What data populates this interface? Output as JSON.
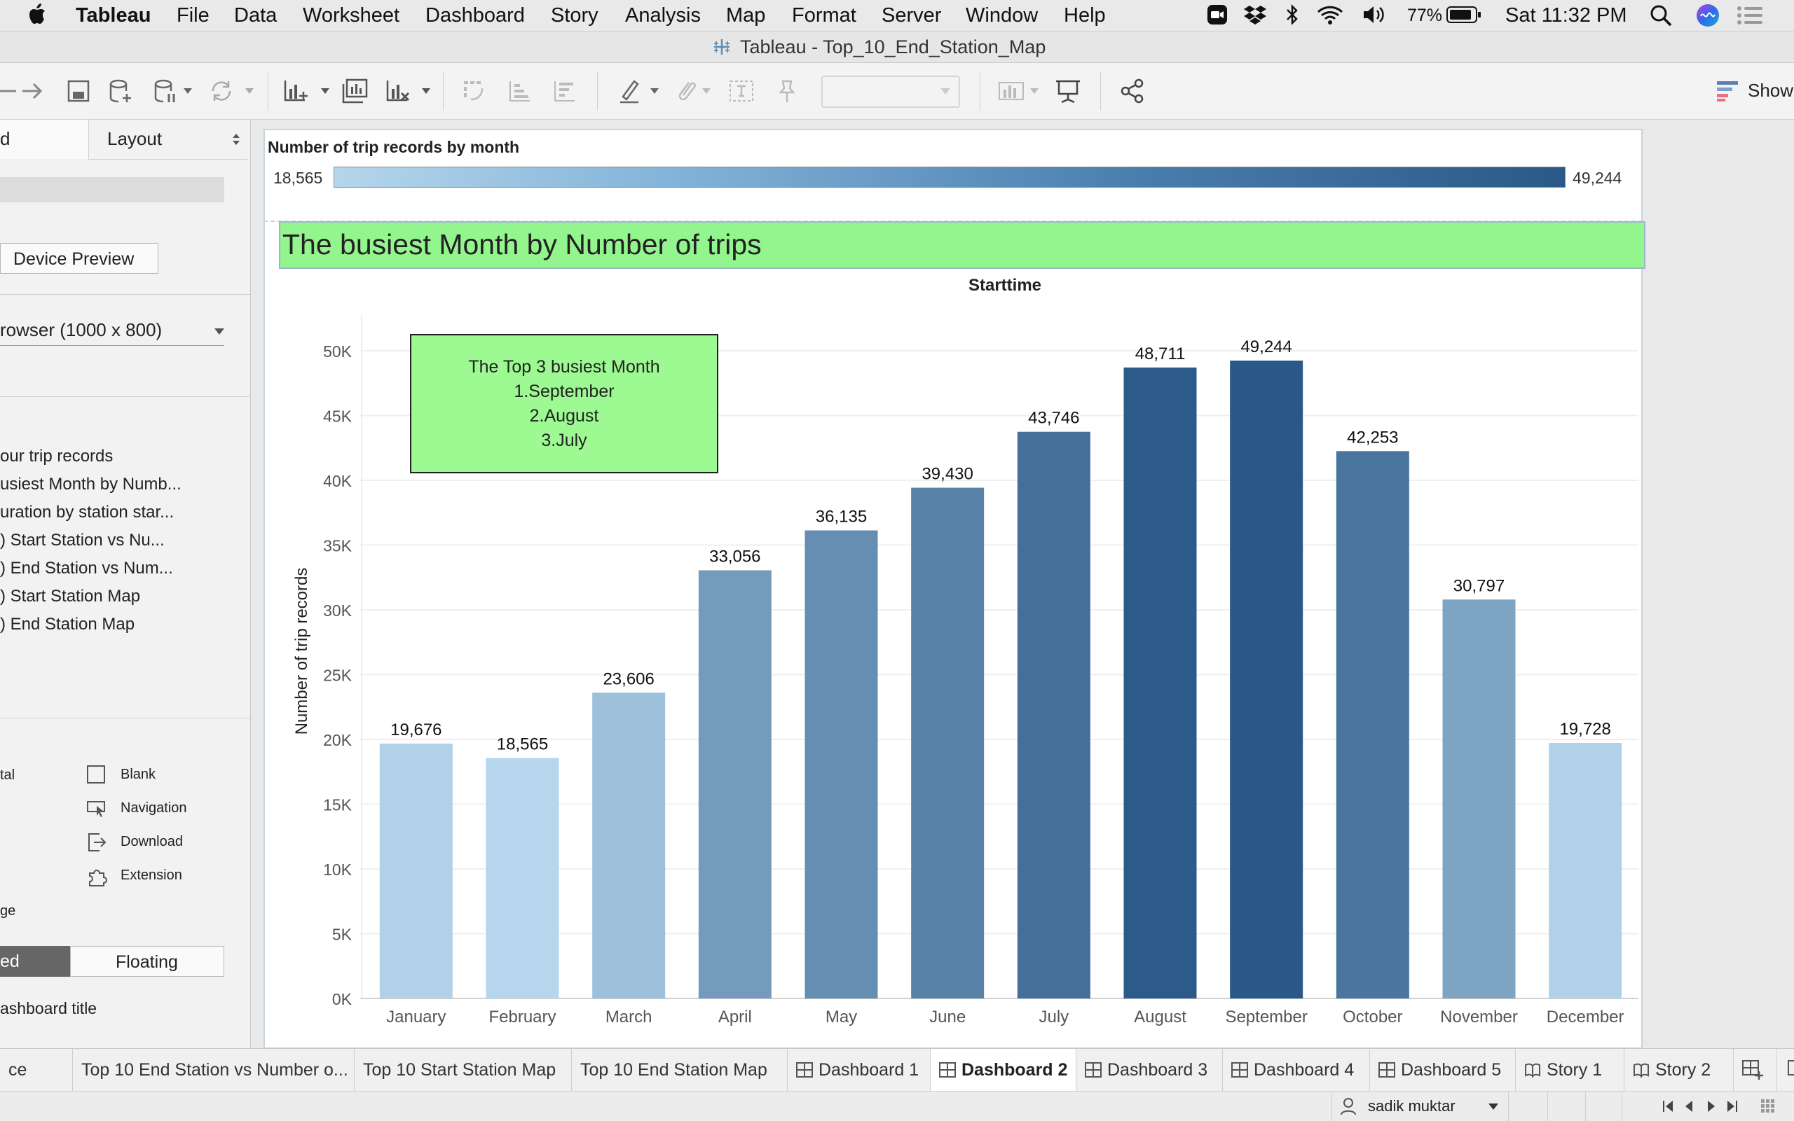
{
  "menubar": {
    "app_name": "Tableau",
    "items": [
      "File",
      "Data",
      "Worksheet",
      "Dashboard",
      "Story",
      "Analysis",
      "Map",
      "Format",
      "Server",
      "Window",
      "Help"
    ],
    "battery": "77%",
    "clock": "Sat 11:32 PM"
  },
  "window": {
    "title": "Tableau - Top_10_End_Station_Map"
  },
  "toolbar": {
    "show_me_label": "Show"
  },
  "left_panel": {
    "tab_dashboard": "d",
    "tab_layout": "Layout",
    "device_preview_label": "Device Preview",
    "size_value": "rowser (1000 x 800)",
    "sheets": [
      "our trip records",
      "usiest Month by Numb...",
      "uration by station star...",
      ") Start Station vs Nu...",
      ") End Station vs Num...",
      ") Start Station Map",
      ") End Station Map"
    ],
    "objects_left": [
      "tal",
      "",
      "",
      "",
      "ge"
    ],
    "objects": [
      "Blank",
      "Navigation",
      "Download",
      "Extension"
    ],
    "tiled_label": "ed",
    "floating_label": "Floating",
    "show_title_label": "ashboard title"
  },
  "dashboard": {
    "legend_title": "Number of trip records by month",
    "legend_min": "18,565",
    "legend_max": "49,244",
    "banner_title": "The busiest Month by Number of trips",
    "annotation_lines": [
      "The Top 3 busiest Month",
      "1.September",
      "2.August",
      "3.July"
    ],
    "colors": {
      "banner_bg": "#93f58e",
      "annotation_bg": "#9df991",
      "bar_light": "#b5d6ec",
      "bar_dark": "#2b5987"
    }
  },
  "chart_data": {
    "type": "bar",
    "title": "Starttime",
    "xlabel": "",
    "ylabel": "Number of trip records",
    "categories": [
      "January",
      "February",
      "March",
      "April",
      "May",
      "June",
      "July",
      "August",
      "September",
      "October",
      "November",
      "December"
    ],
    "values": [
      19676,
      18565,
      23606,
      33056,
      36135,
      39430,
      43746,
      48711,
      49244,
      42253,
      30797,
      19728
    ],
    "value_labels": [
      "19,676",
      "18,565",
      "23,606",
      "33,056",
      "36,135",
      "39,430",
      "43,746",
      "48,711",
      "49,244",
      "42,253",
      "30,797",
      "19,728"
    ],
    "yticks": [
      0,
      5000,
      10000,
      15000,
      20000,
      25000,
      30000,
      35000,
      40000,
      45000,
      50000
    ],
    "ytick_labels": [
      "0K",
      "5K",
      "10K",
      "15K",
      "20K",
      "25K",
      "30K",
      "35K",
      "40K",
      "45K",
      "50K"
    ],
    "ylim": [
      0,
      50000
    ],
    "grid": true
  },
  "sheet_tabs": [
    {
      "label": "ce",
      "icon": "none",
      "active": false
    },
    {
      "label": "Top 10 End Station vs Number o...",
      "icon": "none",
      "active": false
    },
    {
      "label": "Top 10 Start Station Map",
      "icon": "none",
      "active": false
    },
    {
      "label": "Top 10 End Station Map",
      "icon": "none",
      "active": false
    },
    {
      "label": "Dashboard 1",
      "icon": "dashboard-icon",
      "active": false
    },
    {
      "label": "Dashboard 2",
      "icon": "dashboard-icon",
      "active": true
    },
    {
      "label": "Dashboard 3",
      "icon": "dashboard-icon",
      "active": false
    },
    {
      "label": "Dashboard 4",
      "icon": "dashboard-icon",
      "active": false
    },
    {
      "label": "Dashboard 5",
      "icon": "dashboard-icon",
      "active": false
    },
    {
      "label": "Story 1",
      "icon": "story-icon",
      "active": false
    },
    {
      "label": "Story 2",
      "icon": "story-icon",
      "active": false
    }
  ],
  "status": {
    "user": "sadik muktar"
  }
}
